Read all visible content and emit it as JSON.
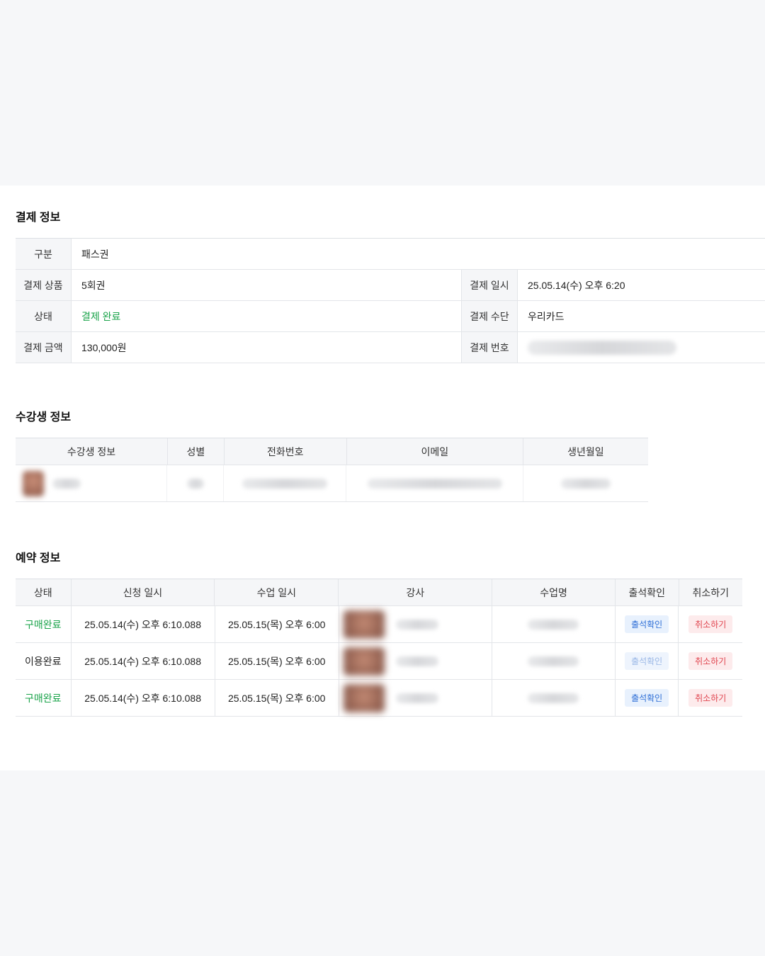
{
  "payment": {
    "title": "결제 정보",
    "category_label": "구분",
    "category_value": "패스권",
    "product_label": "결제 상품",
    "product_value": "5회권",
    "date_label": "결제 일시",
    "date_value": "25.05.14(수) 오후 6:20",
    "status_label": "상태",
    "status_value": "결제 완료",
    "method_label": "결제 수단",
    "method_value": "우리카드",
    "amount_label": "결제 금액",
    "amount_value": "130,000원",
    "number_label": "결제 번호"
  },
  "student": {
    "title": "수강생 정보",
    "headers": [
      "수강생 정보",
      "성별",
      "전화번호",
      "이메일",
      "생년월일"
    ]
  },
  "reservation": {
    "title": "예약 정보",
    "headers": [
      "상태",
      "신청 일시",
      "수업 일시",
      "강사",
      "수업명",
      "출석확인",
      "취소하기"
    ],
    "rows": [
      {
        "status": "구매완료",
        "requested": "25.05.14(수) 오후 6:10.088",
        "class_time": "25.05.15(목) 오후 6:00",
        "attend": "출석확인",
        "cancel": "취소하기"
      },
      {
        "status": "이용완료",
        "requested": "25.05.14(수) 오후 6:10.088",
        "class_time": "25.05.15(목) 오후 6:00",
        "attend": "출석확인",
        "cancel": "취소하기"
      },
      {
        "status": "구매완료",
        "requested": "25.05.14(수) 오후 6:10.088",
        "class_time": "25.05.15(목) 오후 6:00",
        "attend": "출석확인",
        "cancel": "취소하기"
      }
    ]
  },
  "colors": {
    "status_green": "#1aa34a",
    "attend_blue": "#2f6fd6",
    "cancel_red": "#e0454f"
  }
}
